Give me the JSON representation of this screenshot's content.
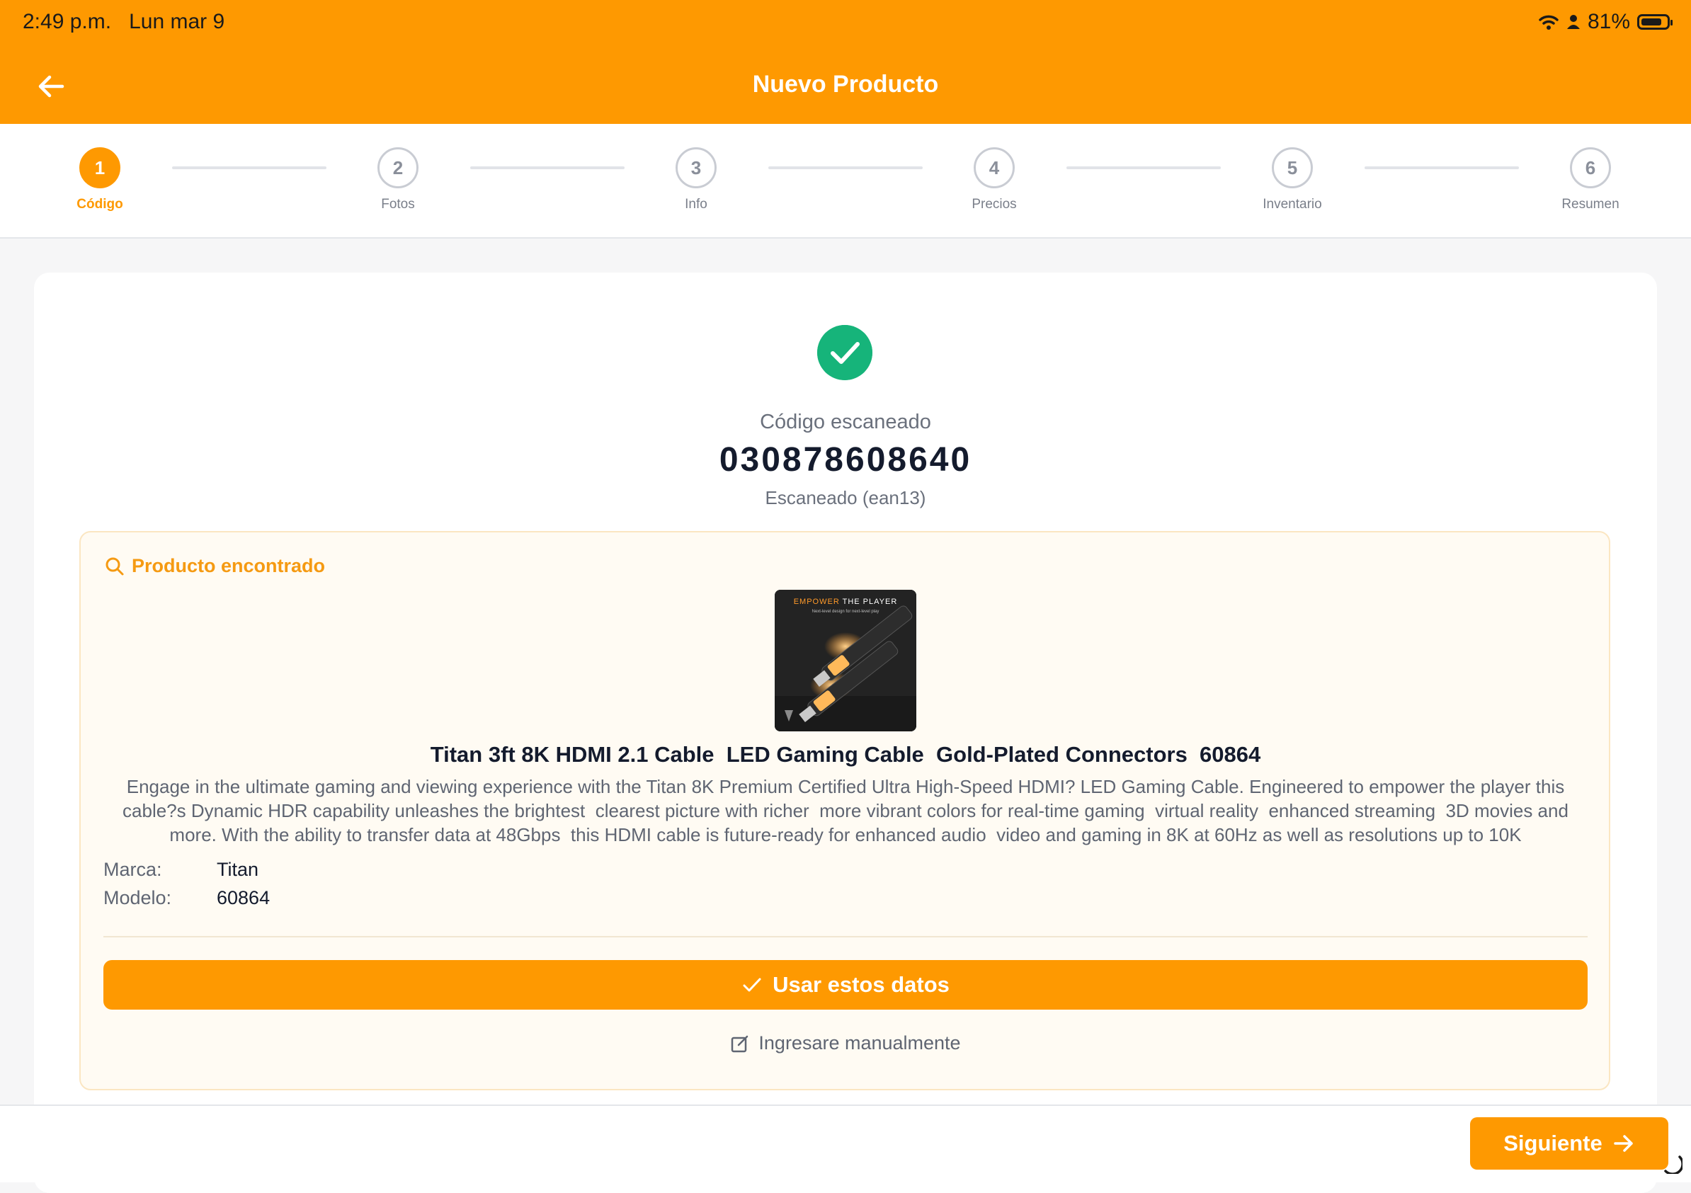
{
  "status_bar": {
    "time": "2:49 p.m.",
    "date": "Lun mar 9",
    "battery": "81%"
  },
  "header": {
    "title": "Nuevo Producto",
    "back_icon": "arrow-left-icon"
  },
  "stepper": {
    "steps": [
      {
        "number": "1",
        "label": "Código",
        "active": true
      },
      {
        "number": "2",
        "label": "Fotos",
        "active": false
      },
      {
        "number": "3",
        "label": "Info",
        "active": false
      },
      {
        "number": "4",
        "label": "Precios",
        "active": false
      },
      {
        "number": "5",
        "label": "Inventario",
        "active": false
      },
      {
        "number": "6",
        "label": "Resumen",
        "active": false
      }
    ]
  },
  "scan": {
    "label": "Código escaneado",
    "code": "030878608640",
    "type_text": "Escaneado (ean13)"
  },
  "product": {
    "section_title": "Producto encontrado",
    "image_caption_brand": "EMPOWER",
    "image_caption_rest": " THE PLAYER",
    "image_subcaption": "Next-level design for next-level play",
    "name": "Titan 3ft 8K HDMI 2.1 Cable  LED Gaming Cable  Gold-Plated Connectors  60864",
    "description": "Engage in the ultimate gaming and viewing experience with the Titan 8K Premium Certified Ultra High-Speed HDMI? LED Gaming Cable. Engineered to empower the player this cable?s Dynamic HDR capability unleashes the brightest  clearest picture with richer  more vibrant colors for real-time gaming  virtual reality  enhanced streaming  3D movies and more. With the ability to transfer data at 48Gbps  this HDMI cable is future-ready for enhanced audio  video and gaming in 8K at 60Hz as well as resolutions up to 10K",
    "brand_label": "Marca:",
    "brand_value": "Titan",
    "model_label": "Modelo:",
    "model_value": "60864"
  },
  "actions": {
    "use_data": "Usar estos datos",
    "manual": "Ingresare manualmente",
    "next": "Siguiente"
  },
  "colors": {
    "accent": "#fe9901",
    "success": "#16b47a"
  }
}
